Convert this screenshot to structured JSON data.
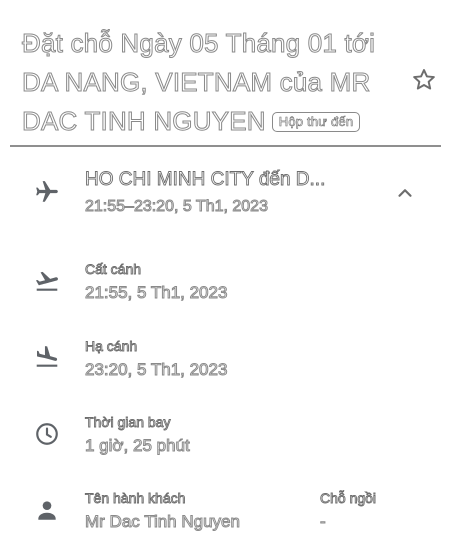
{
  "email": {
    "subject": "Đặt chỗ Ngày 05 Tháng 01 tới DA NANG, VIETNAM của MR DAC TINH NGUYEN",
    "inbox_badge": "Hộp thư đến"
  },
  "flight": {
    "route": "HO CHI MINH CITY đến D...",
    "time_range": "21:55–23:20, 5 Th1, 2023"
  },
  "details": {
    "departure_label": "Cất cánh",
    "departure_value": "21:55, 5 Th1, 2023",
    "arrival_label": "Hạ cánh",
    "arrival_value": "23:20, 5 Th1, 2023",
    "duration_label": "Thời gian bay",
    "duration_value": "1 giờ, 25 phút",
    "passenger_label": "Tên hành khách",
    "passenger_value": "Mr Dac Tinh Nguyen",
    "seat_label": "Chỗ ngồi",
    "seat_value": "-"
  },
  "icons": {
    "star": "star-outline-icon",
    "plane": "airplane-icon",
    "takeoff": "flight-takeoff-icon",
    "landing": "flight-land-icon",
    "clock": "clock-icon",
    "person": "person-icon",
    "chevron": "chevron-up-icon"
  }
}
